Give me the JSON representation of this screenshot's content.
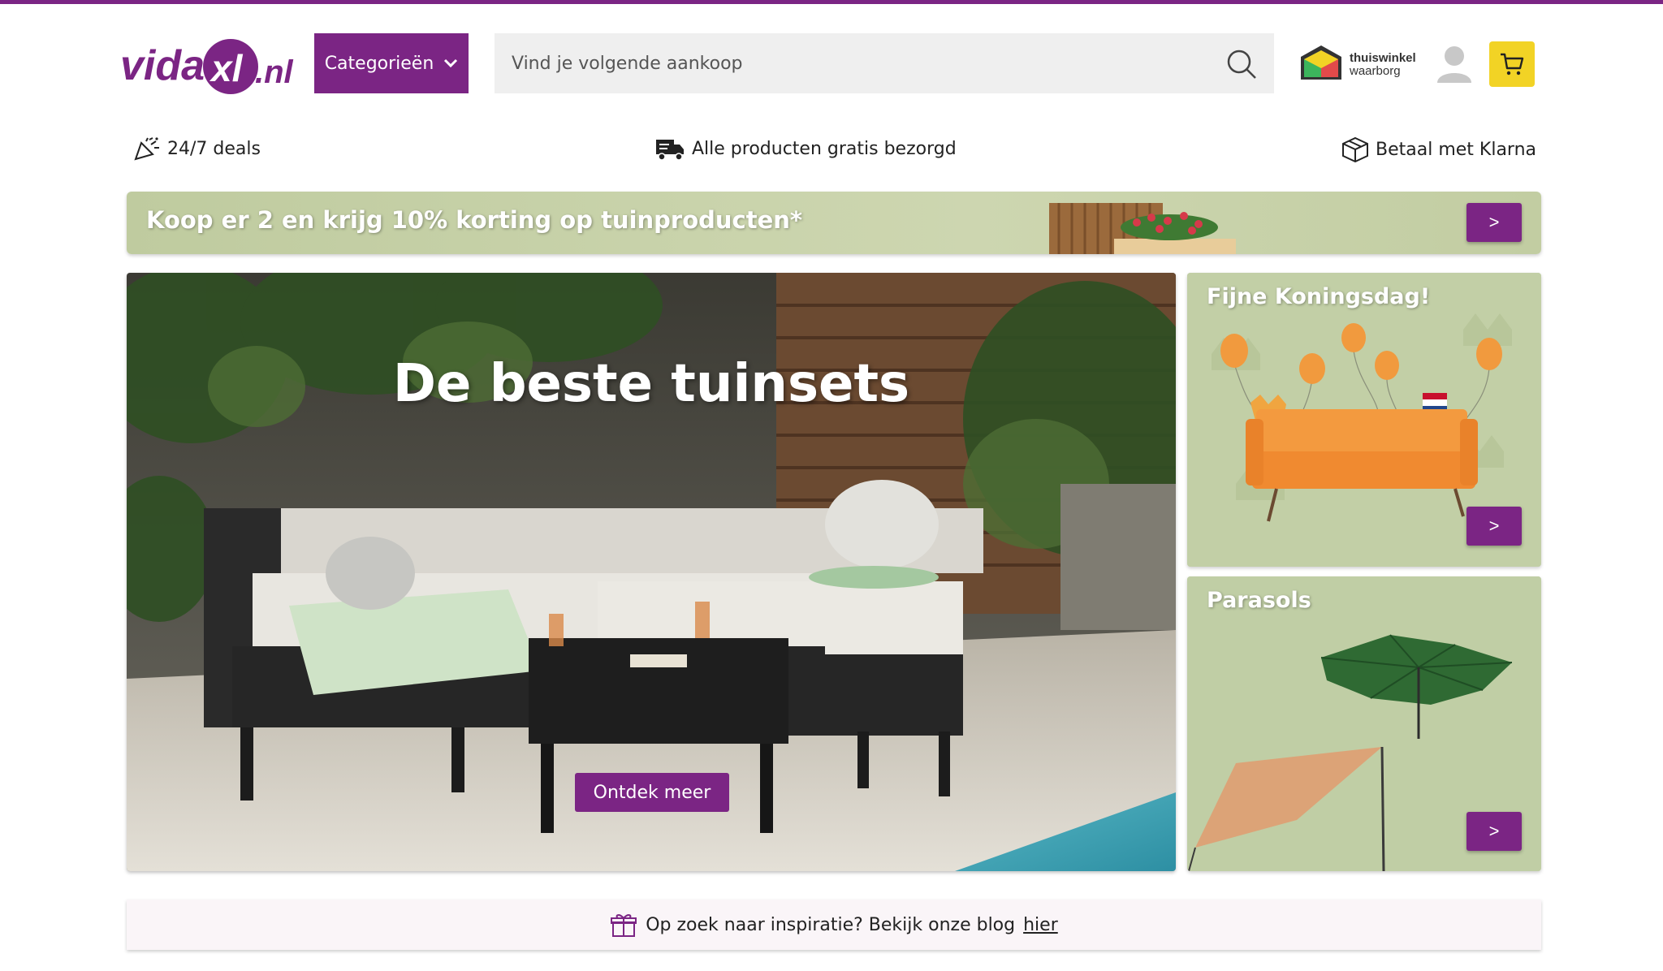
{
  "brand": {
    "name": "vidaXL.nl",
    "accent": "#7b2584",
    "cart_color": "#f2d325"
  },
  "header": {
    "categories_label": "Categorieën",
    "search_placeholder": "Vind je volgende aankoop",
    "trust_title": "thuiswinkel",
    "trust_sub": "waarborg"
  },
  "usps": [
    {
      "icon": "party-popper-icon",
      "label": "24/7 deals"
    },
    {
      "icon": "delivery-truck-icon",
      "label": "Alle producten gratis bezorgd"
    },
    {
      "icon": "package-box-icon",
      "label": "Betaal met Klarna"
    }
  ],
  "promo": {
    "text": "Koop er 2 en krijg 10% korting op tuinproducten*",
    "arrow": ">"
  },
  "hero": {
    "title": "De beste tuinsets",
    "button": "Ontdek meer"
  },
  "tiles": [
    {
      "title": "Fijne Koningsdag!",
      "arrow": ">"
    },
    {
      "title": "Parasols",
      "arrow": ">"
    }
  ],
  "blog": {
    "text": "Op zoek naar inspiratie? Bekijk onze blog",
    "link": "hier"
  }
}
